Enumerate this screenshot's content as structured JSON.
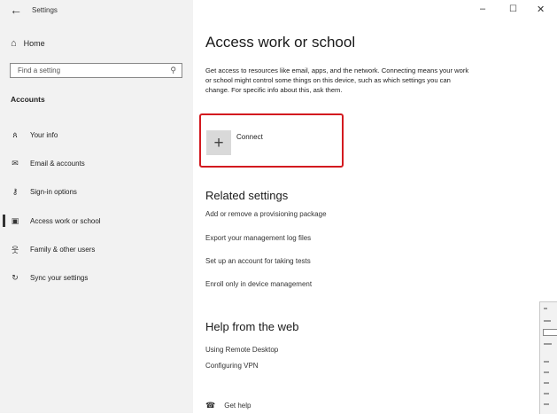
{
  "window": {
    "app_title": "Settings",
    "back_glyph": "←",
    "minimize_glyph": "–",
    "maximize_glyph": "☐",
    "close_glyph": "✕"
  },
  "sidebar": {
    "home": {
      "label": "Home",
      "icon": "home-icon"
    },
    "search": {
      "placeholder": "Find a setting",
      "icon": "search-icon"
    },
    "section_title": "Accounts",
    "items": [
      {
        "label": "Your info",
        "icon": "person-list-icon",
        "selected": false
      },
      {
        "label": "Email & accounts",
        "icon": "envelope-icon",
        "selected": false
      },
      {
        "label": "Sign-in options",
        "icon": "key-icon",
        "selected": false
      },
      {
        "label": "Access work or school",
        "icon": "briefcase-icon",
        "selected": true
      },
      {
        "label": "Family & other users",
        "icon": "person-plus-icon",
        "selected": false
      },
      {
        "label": "Sync your settings",
        "icon": "sync-icon",
        "selected": false
      }
    ]
  },
  "main": {
    "title": "Access work or school",
    "description": "Get access to resources like email, apps, and the network. Connecting means your work or school might control some things on this device, such as which settings you can change. For specific info about this, ask them.",
    "connect_label": "Connect",
    "highlight_color": "#d31a1f",
    "related": {
      "heading": "Related settings",
      "links": [
        "Add or remove a provisioning package",
        "Export your management log files",
        "Set up an account for taking tests",
        "Enroll only in device management"
      ]
    },
    "help": {
      "heading": "Help from the web",
      "links": [
        "Using Remote Desktop",
        "Configuring VPN"
      ]
    },
    "get_help": "Get help"
  }
}
